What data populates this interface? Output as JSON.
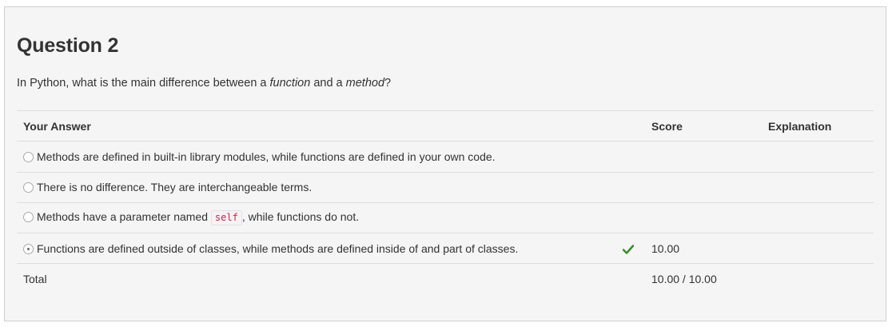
{
  "question": {
    "title": "Question 2",
    "prompt_before": "In Python, what is the main difference between a ",
    "prompt_em1": "function",
    "prompt_middle": " and a ",
    "prompt_em2": "method",
    "prompt_after": "?"
  },
  "table": {
    "headers": {
      "answer": "Your Answer",
      "score": "Score",
      "explanation": "Explanation"
    },
    "options": [
      {
        "text": "Methods are defined in built-in library modules, while functions are defined in your own code.",
        "selected": false
      },
      {
        "text": "There is no difference. They are interchangeable terms.",
        "selected": false
      },
      {
        "text_before": "Methods have a parameter named ",
        "code": "self",
        "text_after": ", while functions do not.",
        "selected": false
      },
      {
        "text": "Functions are defined outside of classes, while methods are defined inside of and part of classes.",
        "selected": true,
        "correct": true,
        "score": "10.00"
      }
    ],
    "total": {
      "label": "Total",
      "score": "10.00 / 10.00"
    }
  },
  "colors": {
    "check": "#3c8d2f",
    "code_text": "#c7254e",
    "panel_bg": "#f5f5f5"
  },
  "icons": {
    "correct": "check-icon",
    "option": "radio-icon"
  }
}
